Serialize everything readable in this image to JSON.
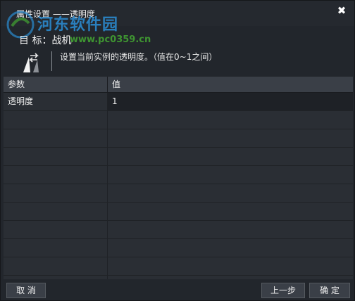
{
  "window": {
    "title": "属性设置 ——透明度",
    "close_glyph": "✖"
  },
  "watermark": {
    "text_cn": "河东软件园",
    "url": "www.pc0359.cn"
  },
  "target": {
    "label": "目 标：战机"
  },
  "description": {
    "icon": "swap-arrows-icon",
    "text": "设置当前实例的透明度。（值在0~1之间）"
  },
  "table": {
    "headers": [
      "参数",
      "值"
    ],
    "rows": [
      {
        "param": "透明度",
        "value": "1"
      },
      {
        "param": "",
        "value": ""
      },
      {
        "param": "",
        "value": ""
      },
      {
        "param": "",
        "value": ""
      },
      {
        "param": "",
        "value": ""
      },
      {
        "param": "",
        "value": ""
      },
      {
        "param": "",
        "value": ""
      },
      {
        "param": "",
        "value": ""
      },
      {
        "param": "",
        "value": ""
      },
      {
        "param": "",
        "value": ""
      },
      {
        "param": "",
        "value": ""
      }
    ]
  },
  "buttons": {
    "cancel": "取 消",
    "prev": "上一步",
    "ok": "确 定"
  }
}
